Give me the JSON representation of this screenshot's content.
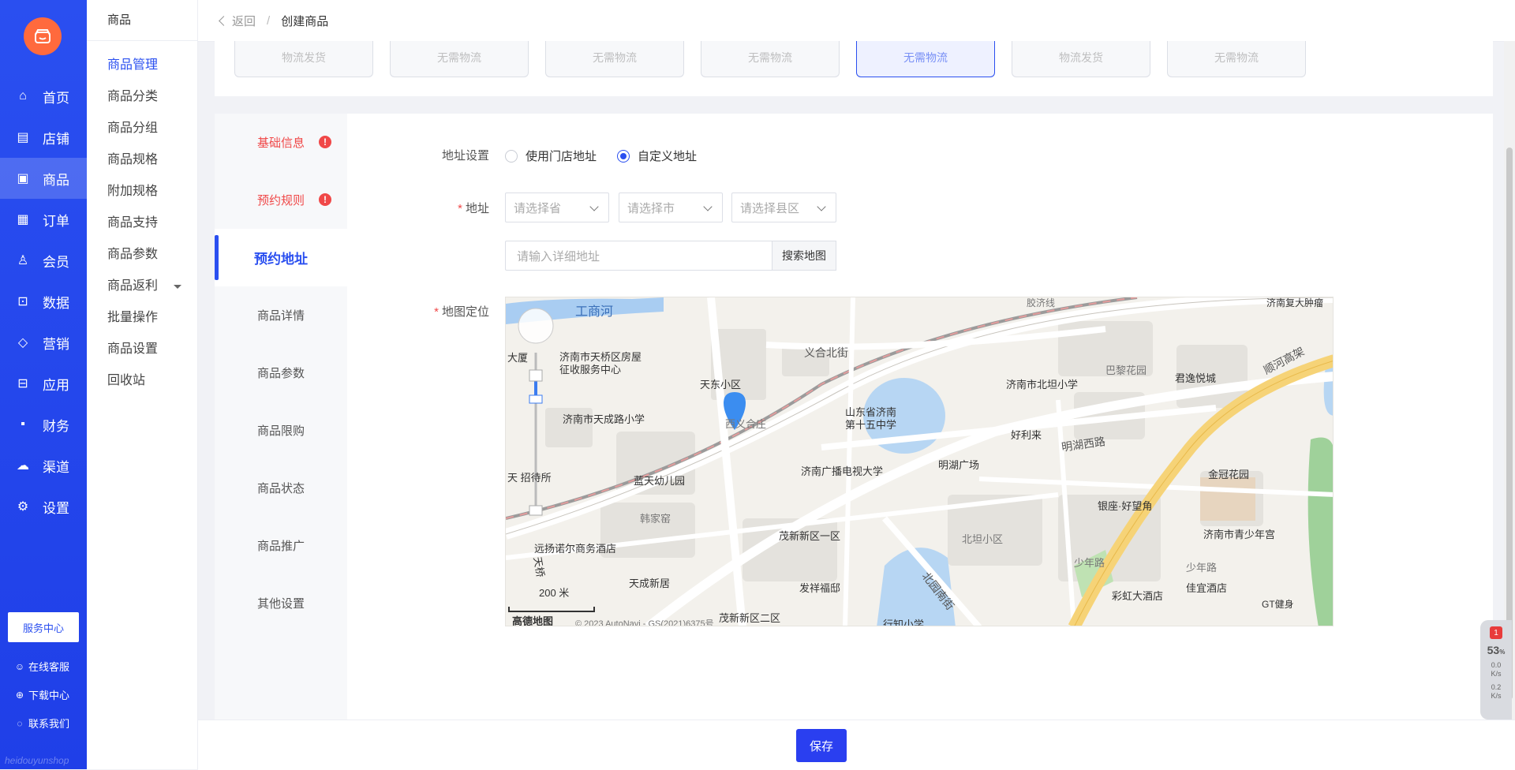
{
  "sidebar": {
    "nav": [
      {
        "label": "首页",
        "icon": "home-icon",
        "glyph": "⌂"
      },
      {
        "label": "店铺",
        "icon": "store-icon",
        "glyph": "▤"
      },
      {
        "label": "商品",
        "icon": "goods-icon",
        "glyph": "▣",
        "active": true
      },
      {
        "label": "订单",
        "icon": "order-icon",
        "glyph": "▦"
      },
      {
        "label": "会员",
        "icon": "member-icon",
        "glyph": "♙"
      },
      {
        "label": "数据",
        "icon": "chart-icon",
        "glyph": "⊡"
      },
      {
        "label": "营销",
        "icon": "tag-icon",
        "glyph": "◇"
      },
      {
        "label": "应用",
        "icon": "app-icon",
        "glyph": "⊟"
      },
      {
        "label": "财务",
        "icon": "finance-icon",
        "glyph": "▪"
      },
      {
        "label": "渠道",
        "icon": "channel-icon",
        "glyph": "☁"
      },
      {
        "label": "设置",
        "icon": "settings-icon",
        "glyph": "⚙"
      }
    ],
    "service_center": "服务中心",
    "online_service": "在线客服",
    "download_center": "下载中心",
    "contact_us": "联系我们",
    "brand_footer": "heidouyunshop"
  },
  "subnav": {
    "title": "商品",
    "items": [
      {
        "label": "商品管理",
        "active": true
      },
      {
        "label": "商品分类"
      },
      {
        "label": "商品分组"
      },
      {
        "label": "商品规格"
      },
      {
        "label": "附加规格"
      },
      {
        "label": "商品支持"
      },
      {
        "label": "商品参数"
      },
      {
        "label": "商品返利",
        "caret": true
      },
      {
        "label": "批量操作"
      },
      {
        "label": "商品设置"
      },
      {
        "label": "回收站"
      }
    ]
  },
  "breadcrumb": {
    "back": "返回",
    "separator": "/",
    "current": "创建商品"
  },
  "templates": [
    "物流发货",
    "无需物流",
    "无需物流",
    "无需物流",
    "无需物流",
    "物流发货",
    "无需物流"
  ],
  "template_active_index": 4,
  "tabs": [
    {
      "label": "基础信息",
      "error": true
    },
    {
      "label": "预约规则",
      "error": true
    },
    {
      "label": "预约地址",
      "active": true
    },
    {
      "label": "商品详情"
    },
    {
      "label": "商品参数"
    },
    {
      "label": "商品限购"
    },
    {
      "label": "商品状态"
    },
    {
      "label": "商品推广"
    },
    {
      "label": "其他设置"
    }
  ],
  "form": {
    "address_setting_label": "地址设置",
    "radio_store": "使用门店地址",
    "radio_custom": "自定义地址",
    "address_label": "地址",
    "province_placeholder": "请选择省",
    "city_placeholder": "请选择市",
    "district_placeholder": "请选择县区",
    "detail_placeholder": "请输入详细地址",
    "search_map": "搜索地图",
    "map_label": "地图定位",
    "required_mark": "*"
  },
  "map": {
    "labels": {
      "river": "工商河",
      "office": "济南市天桥区房屋征收服务中心",
      "tiandong": "天东小区",
      "xiyi": "西义合庄",
      "tiancheng_school": "济南市天成路小学",
      "yihe_north": "义合北街",
      "shandong_15": "山东省济南第十五中学",
      "beitan_school": "济南市北坦小学",
      "bali": "巴黎花园",
      "junyi": "君逸悦城",
      "shunhe": "顺河高架",
      "haolilai": "好利来",
      "minghu_west": "明湖西路",
      "minghu_square": "明湖广场",
      "broadcast_uni": "济南广播电视大学",
      "lantian": "蓝天幼儿园",
      "tian_hotel": "天 招待所",
      "hanjiayao": "韩家窑",
      "maoxin1": "茂新新区一区",
      "yinzuo": "银座·好望角",
      "jinguan": "金冠花园",
      "youth_palace": "济南市青少年宫",
      "beitan_community": "北坦小区",
      "shaonian_rd": "少年路",
      "shaonian_rd2": "少年路",
      "yuanyang": "远扬诺尔商务酒店",
      "tiancheng_new": "天成新居",
      "faxiang": "发祥福邸",
      "beiyuan": "北园南街",
      "caihong": "彩虹大酒店",
      "jiayi": "佳宜酒店",
      "gt": "GT健身",
      "maoxin2": "茂新新区二区",
      "xingzhi": "行知小学",
      "fudan": "济南复大肿瘤",
      "jiaoji": "胶济线",
      "dasha": "大厦",
      "tianqiao": "天桥",
      "scale": "200 米",
      "amap": "高德地图",
      "copyright": "© 2023 AutoNavi - GS(2021)6375号"
    }
  },
  "save_label": "保存",
  "perf": {
    "badge": "1",
    "pct": "53",
    "pct_unit": "%",
    "up": "0.0",
    "down": "0.2",
    "unit": "K/s"
  }
}
